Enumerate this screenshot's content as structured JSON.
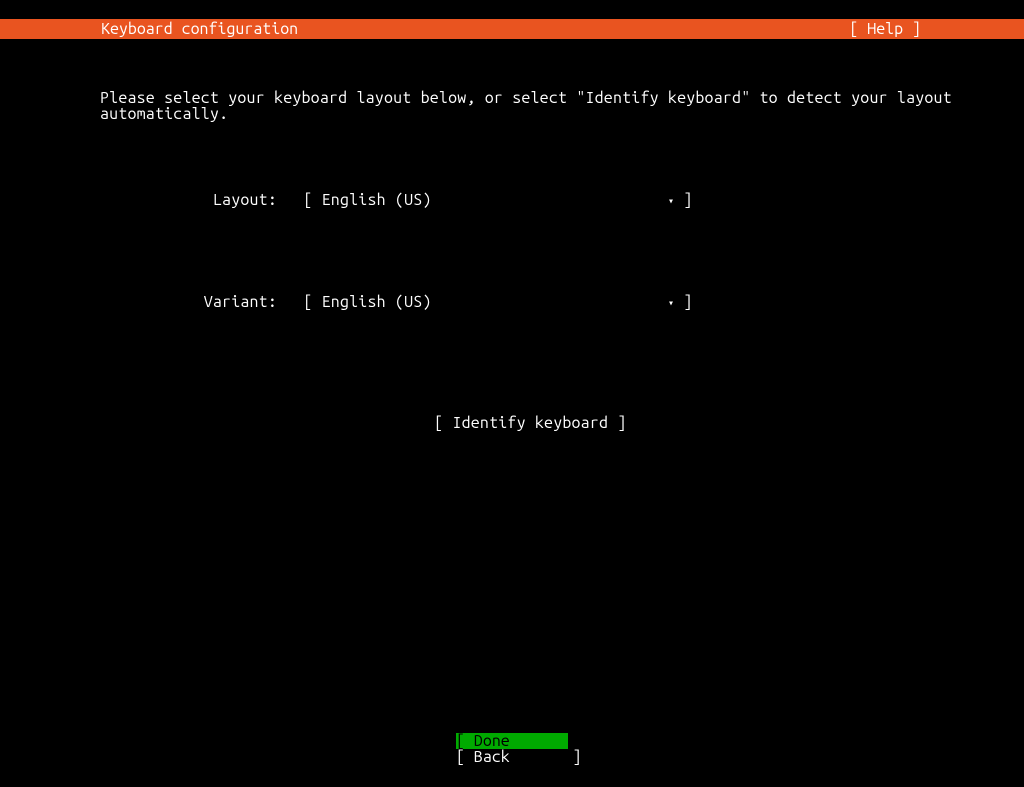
{
  "header": {
    "title": "Keyboard configuration",
    "help": "[ Help ]"
  },
  "instruction": "Please select your keyboard layout below, or select \"Identify keyboard\" to detect your layout\nautomatically.",
  "layout": {
    "label": "Layout:",
    "value": "[ English (US)",
    "close": "]"
  },
  "variant": {
    "label": "Variant:",
    "value": "[ English (US)",
    "close": "]"
  },
  "identify": {
    "label": "[ Identify keyboard ]"
  },
  "arrow": "▾",
  "footer": {
    "done": "[ Done       ]",
    "back": "[ Back       ]"
  }
}
